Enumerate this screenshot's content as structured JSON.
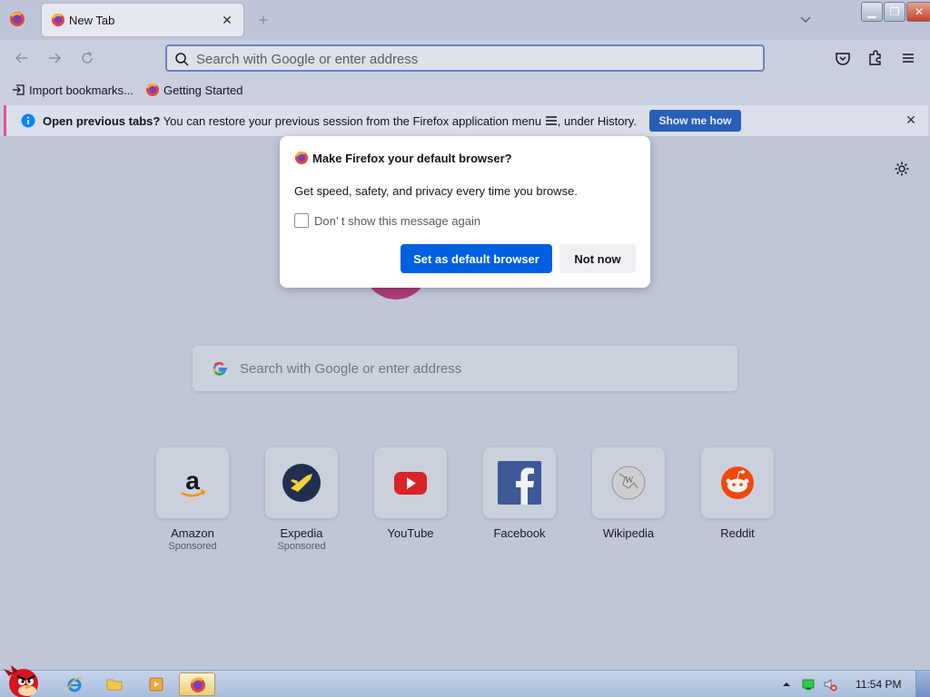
{
  "browser": {
    "tab": {
      "title": "New Tab"
    },
    "urlbar": {
      "placeholder": "Search with Google or enter address"
    },
    "bookmarks": [
      {
        "label": "Import bookmarks..."
      },
      {
        "label": "Getting Started"
      }
    ],
    "notification": {
      "bold": "Open previous tabs?",
      "text": " You can restore your previous session from the Firefox application menu ",
      "text_after": ", under History.",
      "button": "Show me how"
    }
  },
  "newtab": {
    "search_placeholder": "Search with Google or enter address",
    "top_sites": [
      {
        "name": "Amazon",
        "sub": "Sponsored",
        "icon": "amazon-icon"
      },
      {
        "name": "Expedia",
        "sub": "Sponsored",
        "icon": "expedia-icon"
      },
      {
        "name": "YouTube",
        "sub": "",
        "icon": "youtube-icon"
      },
      {
        "name": "Facebook",
        "sub": "",
        "icon": "facebook-icon"
      },
      {
        "name": "Wikipedia",
        "sub": "",
        "icon": "wikipedia-icon"
      },
      {
        "name": "Reddit",
        "sub": "",
        "icon": "reddit-icon"
      }
    ]
  },
  "dialog": {
    "title": "Make Firefox your default browser?",
    "body": "Get speed, safety, and privacy every time you browse.",
    "checkbox_label": "Don’ t show this message again",
    "checkbox_checked": false,
    "primary_button": "Set as default browser",
    "secondary_button": "Not now"
  },
  "taskbar": {
    "clock": "11:54 PM"
  },
  "colors": {
    "primary_button": "#0060df",
    "notification_button": "#2a5fb8",
    "notification_accent": "#e25593"
  }
}
